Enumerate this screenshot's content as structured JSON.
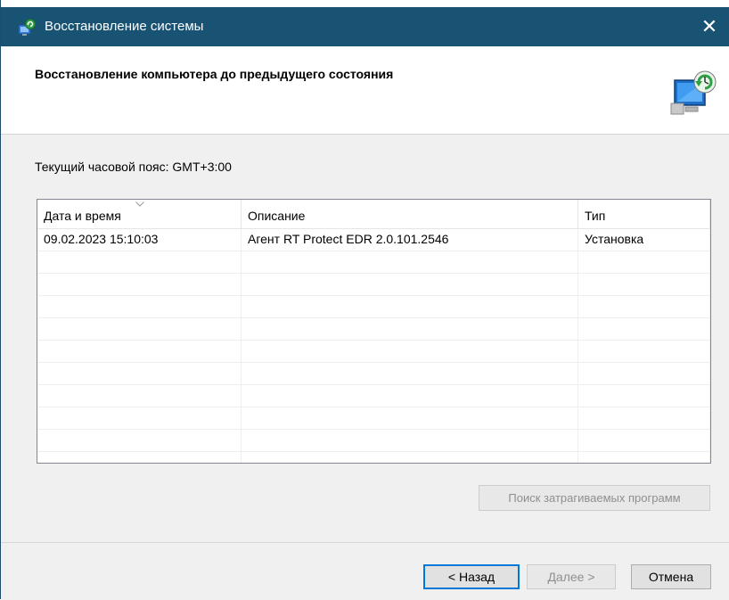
{
  "window": {
    "title": "Восстановление системы",
    "close_symbol": "✕"
  },
  "header": {
    "title": "Восстановление компьютера до предыдущего состояния"
  },
  "timezone_text": "Текущий часовой пояс: GMT+3:00",
  "restore_points": {
    "columns": [
      "Дата и время",
      "Описание",
      "Тип"
    ],
    "rows": [
      {
        "datetime": "09.02.2023 15:10:03",
        "description": "Агент RT Protect EDR 2.0.101.2546",
        "type": "Установка"
      }
    ],
    "sort_column": "Дата и время"
  },
  "buttons": {
    "scan": "Поиск затрагиваемых программ",
    "back": "< Назад",
    "next": "Далее >",
    "cancel": "Отмена"
  },
  "colors": {
    "titlebar": "#195374",
    "focus_border": "#0078d7"
  },
  "icons": {
    "title": "system-restore-icon",
    "header": "computer-restore-icon",
    "close": "close-icon",
    "sort": "chevron-down-icon"
  }
}
